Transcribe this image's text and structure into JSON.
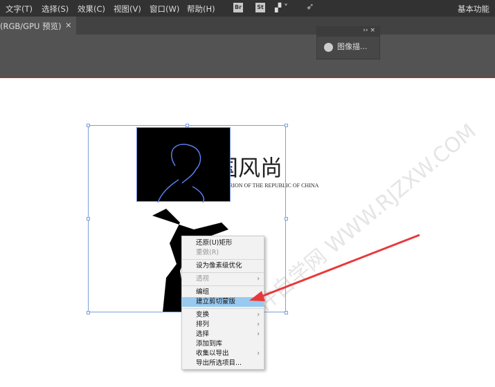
{
  "menubar": {
    "items": [
      "文字(T)",
      "选择(S)",
      "效果(C)",
      "视图(V)",
      "窗口(W)",
      "帮助(H)"
    ],
    "br": "Br",
    "st": "St",
    "workspace": "基本功能"
  },
  "tab": {
    "label": "(RGB/GPU 预览)",
    "close": "×"
  },
  "panel": {
    "controls": "›› ×",
    "item": "图像描..."
  },
  "artwork": {
    "title": "国风尚",
    "subtitle": "RION OF THE REPUBLIC OF CHINA"
  },
  "watermark": "软件自学网 WWW.RJZXW.COM",
  "context_menu": {
    "items": [
      {
        "label": "还原(U)矩形"
      },
      {
        "label": "重做(R)",
        "disabled": true
      },
      {
        "label": "设为像素级优化"
      },
      {
        "label": "透视",
        "disabled": true,
        "submenu": true
      },
      {
        "label": "编组"
      },
      {
        "label": "建立剪切蒙版",
        "highlighted": true
      },
      {
        "label": "变换",
        "submenu": true
      },
      {
        "label": "排列",
        "submenu": true
      },
      {
        "label": "选择",
        "submenu": true
      },
      {
        "label": "添加到库"
      },
      {
        "label": "收集以导出",
        "submenu": true
      },
      {
        "label": "导出所选项目..."
      }
    ],
    "arrow": "›"
  },
  "colors": {
    "highlight": "#99c9ef",
    "annotation_arrow": "#e8393a",
    "selection": "#7a9fd8"
  }
}
